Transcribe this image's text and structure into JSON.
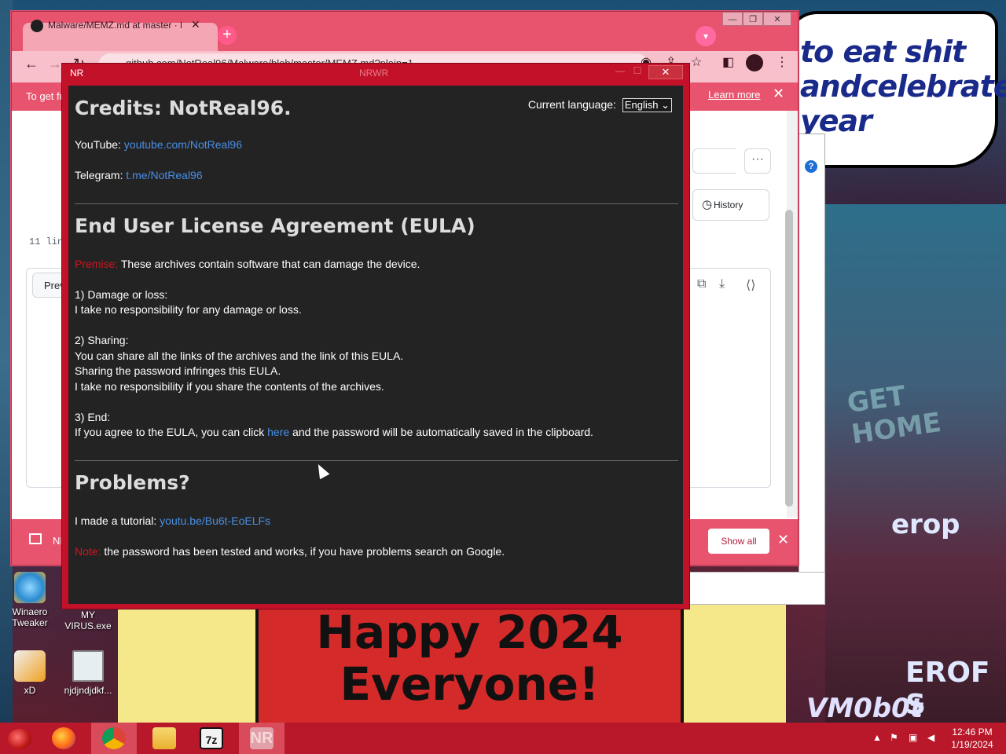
{
  "wallpaper": {
    "bubble_text": "to eat shit andcelebrate year",
    "city_text_1": "GET HOME",
    "city_text_2": "erop",
    "city_text_3": "EROF S",
    "city_text_4": "VM0b0t",
    "happy_line_1": "Happy 2024",
    "happy_line_2": "Everyone!"
  },
  "desktop_icons": [
    {
      "label": "Winaero Tweaker",
      "color": "#3aa0e0"
    },
    {
      "label": "MY VIRUS.exe",
      "color": "#2a5a8a"
    },
    {
      "label": "xD",
      "color": "#f0a020"
    },
    {
      "label": "njdjndjdkf...",
      "color": "#d8e4ea"
    }
  ],
  "chrome": {
    "tab_title": "Malware/MEMZ.md at master · N",
    "omnibox_url": "github.com/NotReal96/Malware/blob/master/MEMZ.md?plain=1",
    "infobar_text": "To get fu",
    "learn_more": "Learn more",
    "history_label": "History",
    "lines_text": "11 lin",
    "preview_label": "Prev",
    "show_all_label": "Show all",
    "download_name": "NI"
  },
  "nr_window": {
    "title": "NR",
    "title_center": "NRWR",
    "language_label": "Current language:",
    "language_value": "English",
    "credits_heading": "Credits: NotReal96.",
    "youtube_label": "YouTube: ",
    "youtube_link": "youtube.com/NotReal96",
    "telegram_label": "Telegram: ",
    "telegram_link": "t.me/NotReal96",
    "eula_heading": "End User License Agreement (EULA)",
    "premise_label": "Premise:",
    "premise_text": " These archives contain software that can damage the device.",
    "damage_title": "1) Damage or loss:",
    "damage_text": "I take no responsibility for any damage or loss.",
    "sharing_title": "2) Sharing:",
    "sharing_line_1": "You can share all the links of the archives and the link of this EULA.",
    "sharing_line_2": "Sharing the password infringes this EULA.",
    "sharing_line_3": "I take no responsibility if you share the contents of the archives.",
    "end_title": "3) End:",
    "end_before": "If you agree to the EULA, you can click ",
    "end_link": "here",
    "end_after": " and the password will be automatically saved in the clipboard.",
    "problems_heading": "Problems?",
    "tutorial_label": "I made a tutorial: ",
    "tutorial_link": "youtu.be/Bu6t-EoELFs",
    "note_label": "Note:",
    "note_text": " the password has been tested and works, if you have problems search on Google."
  },
  "taskbar": {
    "items": [
      {
        "name": "firefox",
        "label": ""
      },
      {
        "name": "chrome",
        "label": ""
      },
      {
        "name": "explorer",
        "label": ""
      },
      {
        "name": "7zip",
        "label": "7z"
      },
      {
        "name": "nr",
        "label": "NR"
      }
    ],
    "time": "12:46 PM",
    "date": "1/19/2024"
  }
}
